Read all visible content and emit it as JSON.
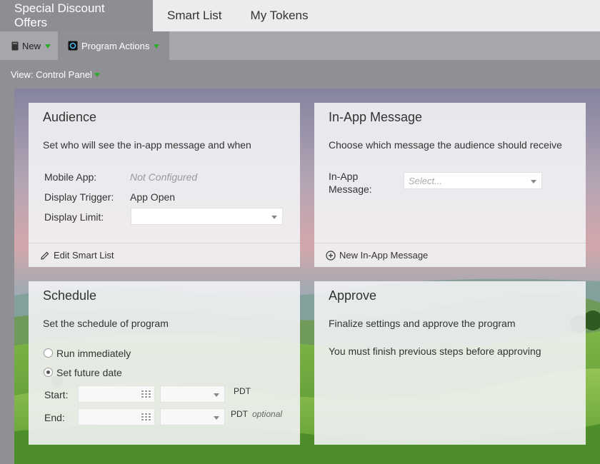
{
  "tabs": [
    {
      "label": "Special Discount Offers"
    },
    {
      "label": "Smart List"
    },
    {
      "label": "My Tokens"
    }
  ],
  "toolbar": {
    "new_label": "New",
    "program_actions_label": "Program Actions"
  },
  "view": {
    "label": "View: Control Panel"
  },
  "audience": {
    "title": "Audience",
    "description": "Set who will see the in-app message and when",
    "mobile_app_label": "Mobile App:",
    "mobile_app_value": "Not Configured",
    "display_trigger_label": "Display Trigger:",
    "display_trigger_value": "App Open",
    "display_limit_label": "Display Limit:",
    "footer_link": "Edit Smart List"
  },
  "inapp": {
    "title": "In-App Message",
    "description": "Choose which message the audience should receive",
    "message_label_line1": "In-App",
    "message_label_line2": "Message:",
    "select_placeholder": "Select...",
    "footer_link": "New In-App Message"
  },
  "schedule": {
    "title": "Schedule",
    "description": "Set the schedule of program",
    "run_immediately": "Run immediately",
    "set_future_date": "Set future date",
    "selected_option": "Set future date",
    "start_label": "Start:",
    "end_label": "End:",
    "timezone": "PDT",
    "optional": "optional"
  },
  "approve": {
    "title": "Approve",
    "description": "Finalize settings and approve the program",
    "note": "You must finish previous steps before approving"
  },
  "colors": {
    "topbar_bg": "#ececef",
    "active_tab_bg": "#8d8d92",
    "toolbar_bg": "#a6a6ab",
    "caret_green": "#2eaa2e"
  }
}
